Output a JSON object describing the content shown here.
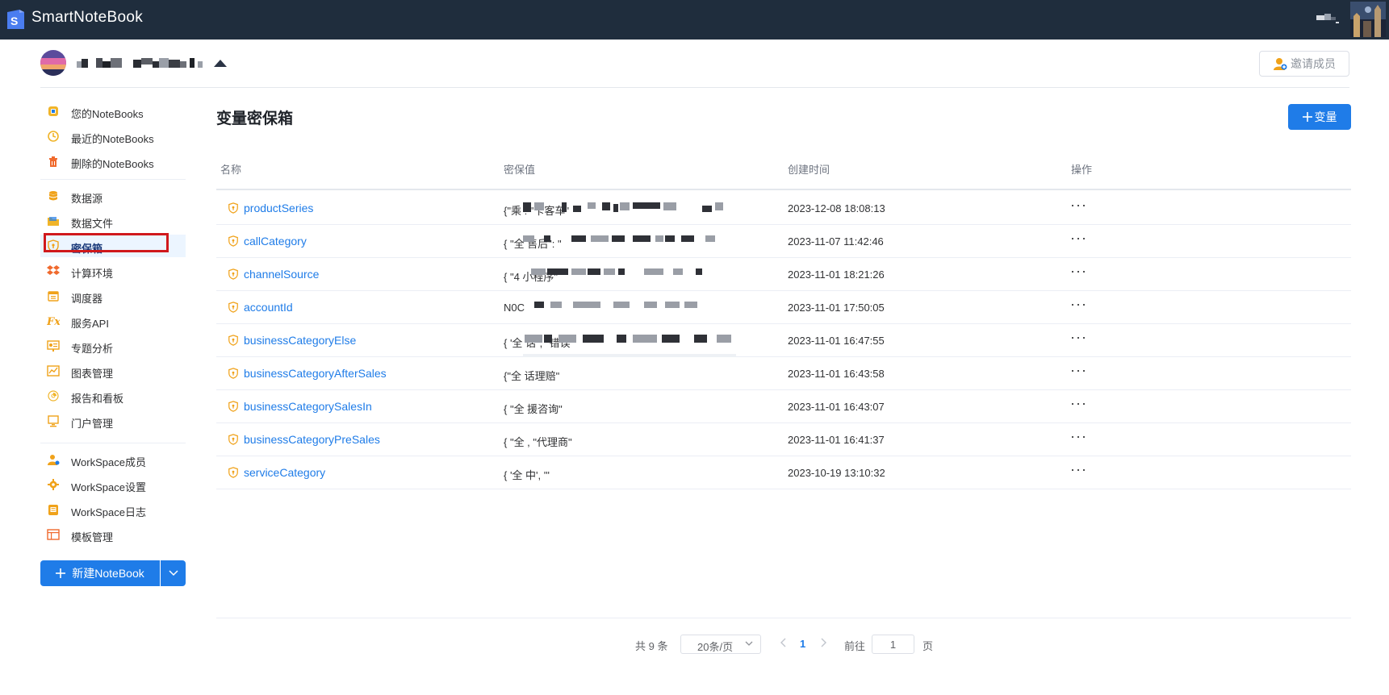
{
  "app": {
    "title": "SmartNoteBook",
    "logo_letter": "S"
  },
  "workspace": {
    "invite_label": "邀请成员"
  },
  "sidebar": {
    "groups": [
      [
        {
          "label": "您的NoteBooks",
          "icon": "notebook-icon",
          "color": "#f0b429"
        },
        {
          "label": "最近的NoteBooks",
          "icon": "clock-icon",
          "color": "#f0b429"
        },
        {
          "label": "删除的NoteBooks",
          "icon": "trash-icon",
          "color": "#f06a2d"
        }
      ],
      [
        {
          "label": "数据源",
          "icon": "database-icon",
          "color": "#f0a21a"
        },
        {
          "label": "数据文件",
          "icon": "folder-icon",
          "color": "#f0b429"
        },
        {
          "label": "密保箱",
          "icon": "vault-icon",
          "color": "#f0a21a",
          "active": true
        },
        {
          "label": "计算环境",
          "icon": "dropbox-icon",
          "color": "#f06a2d"
        },
        {
          "label": "调度器",
          "icon": "calendar-icon",
          "color": "#f0a21a"
        },
        {
          "label": "服务API",
          "icon": "function-icon",
          "color": "#f0a21a"
        },
        {
          "label": "专题分析",
          "icon": "presentation-icon",
          "color": "#f0a21a"
        },
        {
          "label": "图表管理",
          "icon": "line-chart-icon",
          "color": "#f0a21a"
        },
        {
          "label": "报告和看板",
          "icon": "report-icon",
          "color": "#f0b429"
        },
        {
          "label": "门户管理",
          "icon": "monitor-icon",
          "color": "#f0a21a"
        }
      ],
      [
        {
          "label": "WorkSpace成员",
          "icon": "member-icon",
          "color": "#f0a21a"
        },
        {
          "label": "WorkSpace设置",
          "icon": "gear-icon",
          "color": "#f0a21a"
        },
        {
          "label": "WorkSpace日志",
          "icon": "log-icon",
          "color": "#f0a21a"
        },
        {
          "label": "模板管理",
          "icon": "template-icon",
          "color": "#f06a2d"
        }
      ]
    ],
    "new_notebook_label": "新建NoteBook"
  },
  "main": {
    "title": "变量密保箱",
    "add_button_label": "变量",
    "columns": [
      "名称",
      "密保值",
      "创建时间",
      "操作"
    ],
    "rows": [
      {
        "name": "productSeries",
        "value": "{\"乘                                              : \"卡客车\"",
        "created": "2023-12-08 18:08:13"
      },
      {
        "name": "callCategory",
        "value": "{ \"全                                               售后\": \"",
        "created": "2023-11-07 11:42:46"
      },
      {
        "name": "channelSource",
        "value": "{ \"4                                              小程序\"",
        "created": "2023-11-01 18:21:26"
      },
      {
        "name": "accountId",
        "value": "N0C",
        "created": "2023-11-01 17:50:05"
      },
      {
        "name": "businessCategoryElse",
        "value": "{ '全                                              话\", \"错误\"",
        "created": "2023-11-01 16:47:55"
      },
      {
        "name": "businessCategoryAfterSales",
        "value": "{\"全                                               话理赔\"",
        "created": "2023-11-01 16:43:58"
      },
      {
        "name": "businessCategorySalesIn",
        "value": "{ \"全                                               援咨询\"",
        "created": "2023-11-01 16:43:07"
      },
      {
        "name": "businessCategoryPreSales",
        "value": "{ \"全                                              , \"代理商\"",
        "created": "2023-11-01 16:41:37"
      },
      {
        "name": "serviceCategory",
        "value": "{ '全                                               中', '\"",
        "created": "2023-10-19 13:10:32"
      }
    ],
    "ops_glyph": "···"
  },
  "pagination": {
    "total_label": "共 9 条",
    "page_size_label": "20条/页",
    "current_page": "1",
    "goto_label": "前往",
    "goto_value": "1",
    "page_suffix": "页"
  },
  "colors": {
    "accent": "#1f7ce8",
    "topbar": "#1f2d3d",
    "highlight_box": "#d0191c"
  }
}
